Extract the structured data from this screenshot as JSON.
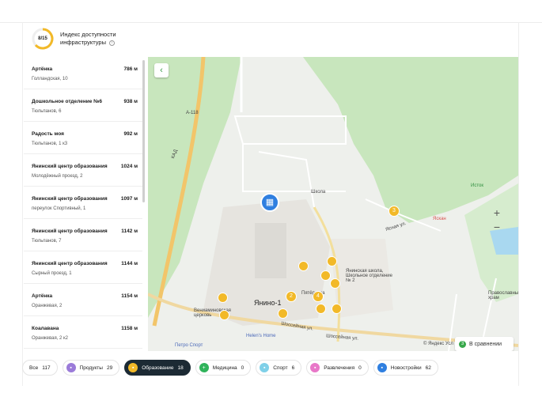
{
  "header": {
    "score": "8/15",
    "title": "Индекс доступности инфраструктуры"
  },
  "list": [
    {
      "name": "Артёнка",
      "address": "Голландская, 10",
      "distance": "786 м"
    },
    {
      "name": "Дошкольное отделение №6",
      "address": "Тюльпанов, 6",
      "distance": "938 м"
    },
    {
      "name": "Радость моя",
      "address": "Тюльпанов, 1 к3",
      "distance": "992 м"
    },
    {
      "name": "Янинский центр образования",
      "address": "Молодёжный проезд, 2",
      "distance": "1024 м"
    },
    {
      "name": "Янинский центр образования",
      "address": "переулок Спортивный, 1",
      "distance": "1097 м"
    },
    {
      "name": "Янинский центр образования",
      "address": "Тюльпанов, 7",
      "distance": "1142 м"
    },
    {
      "name": "Янинский центр образования",
      "address": "Сырный проезд, 1",
      "distance": "1144 м"
    },
    {
      "name": "Артёнка",
      "address": "Оранжевая, 2",
      "distance": "1154 м"
    },
    {
      "name": "Коалавана",
      "address": "Оранжевая, 2 к2",
      "distance": "1158 м"
    }
  ],
  "map": {
    "labels": {
      "road_kad": "КАД",
      "road_a118": "А-118",
      "school": "Школа",
      "istok": "Исток",
      "yaskan": "Яскан",
      "yanino": "Янино-1",
      "school_full": "Янинская школа, Школьное отделение № 2",
      "shosseynaya": "Шоссейная ул.",
      "shosseynaya2": "Шоссейная ул.",
      "helens": "Helen's Home",
      "petro": "Петро Спорт",
      "church": "Вениаминовская церковь",
      "pravoslav": "Православный храм",
      "yasnaya": "Ясная ул.",
      "petrol": "Пятёрочка",
      "yandex": "© Яндекс Усл"
    },
    "cluster_values": [
      "3",
      "2",
      "4"
    ],
    "compare_label": "В сравнении",
    "compare_count": "3"
  },
  "filters": [
    {
      "label": "Все",
      "count": "117",
      "icon": "",
      "color": ""
    },
    {
      "label": "Продукты",
      "count": "29",
      "icon": "cart-icon",
      "color": "#9b7bd9"
    },
    {
      "label": "Образование",
      "count": "18",
      "icon": "education-icon",
      "color": "#f2b928",
      "active": true
    },
    {
      "label": "Медицина",
      "count": "0",
      "icon": "medicine-icon",
      "color": "#2fb35a"
    },
    {
      "label": "Спорт",
      "count": "6",
      "icon": "sport-icon",
      "color": "#7fd0e8"
    },
    {
      "label": "Развлечения",
      "count": "0",
      "icon": "entertainment-icon",
      "color": "#e877c8"
    },
    {
      "label": "Новостройки",
      "count": "62",
      "icon": "building-icon",
      "color": "#2f7fe0"
    }
  ]
}
